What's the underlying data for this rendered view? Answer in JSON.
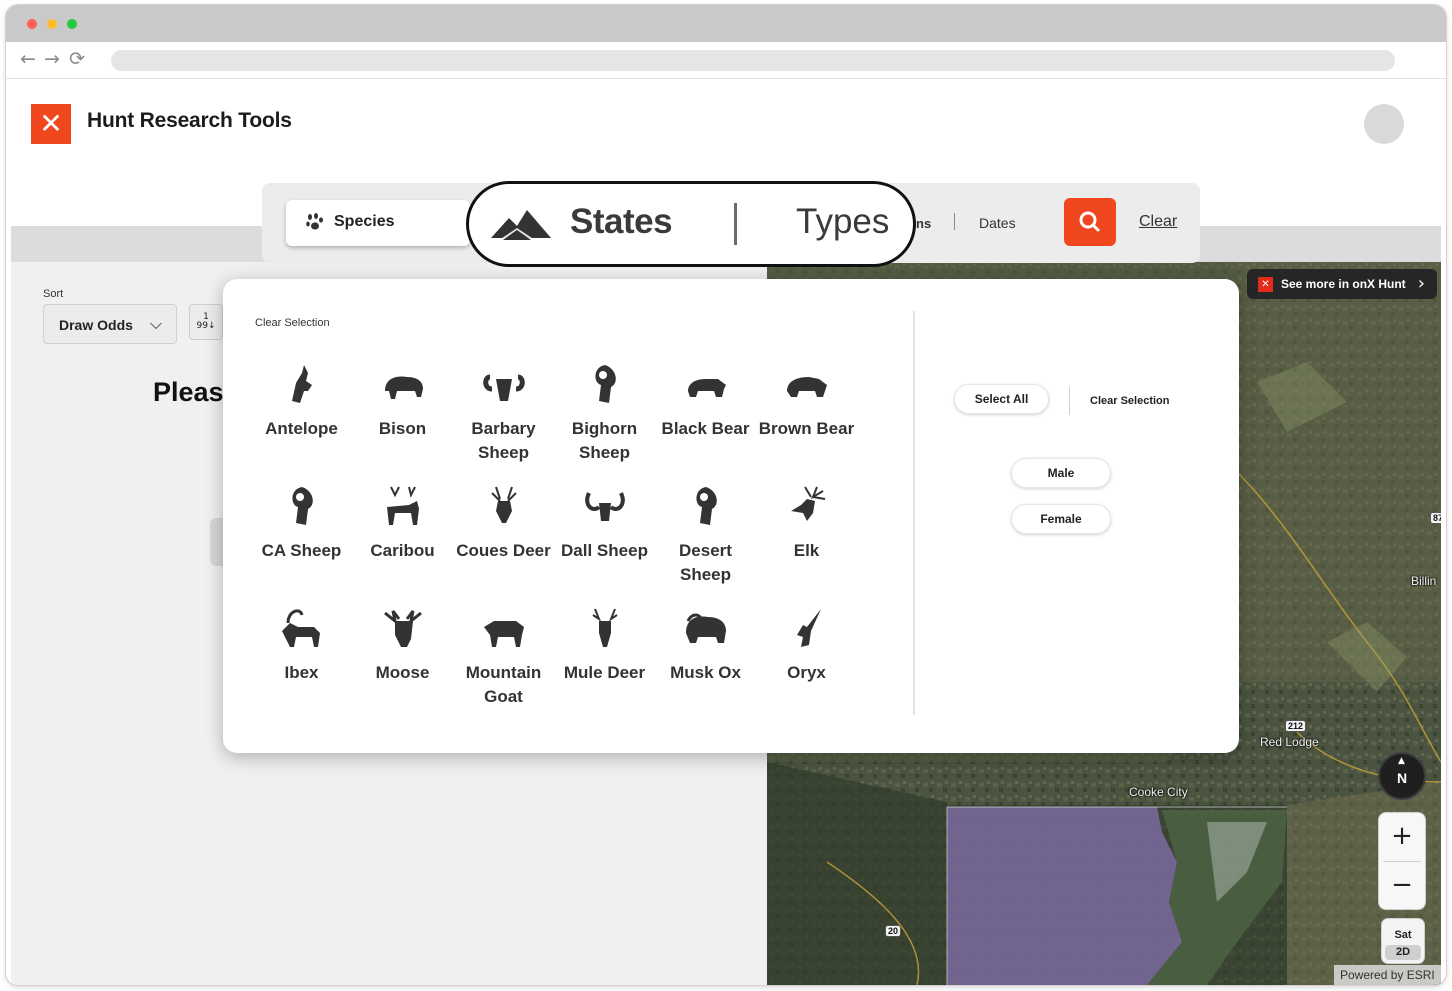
{
  "app": {
    "title": "Hunt Research Tools",
    "logo_glyph": "✕",
    "accent_color": "#f1471e"
  },
  "browser": {
    "back_glyph": "←",
    "forward_glyph": "→",
    "reload_glyph": "⟳"
  },
  "sidebar": {
    "sort_label": "Sort",
    "sort_value": "Draw Odds",
    "sort_chevron": "⌵",
    "sort_direction_top": "1",
    "sort_direction_bottom": "99↓",
    "prompt_partial": "Pleas"
  },
  "filters": {
    "species_label": "Species",
    "states_label": "States",
    "types_label": "Types",
    "seasons_partial": "ns",
    "dates_label": "Dates",
    "clear_label": "Clear"
  },
  "species_panel": {
    "clear_selection": "Clear Selection",
    "species": [
      {
        "name": "Antelope",
        "icon": "antelope-icon"
      },
      {
        "name": "Bison",
        "icon": "bison-icon"
      },
      {
        "name": "Barbary Sheep",
        "icon": "barbary-sheep-icon"
      },
      {
        "name": "Bighorn Sheep",
        "icon": "bighorn-sheep-icon"
      },
      {
        "name": "Black Bear",
        "icon": "black-bear-icon"
      },
      {
        "name": "Brown Bear",
        "icon": "brown-bear-icon"
      },
      {
        "name": "CA Sheep",
        "icon": "ca-sheep-icon"
      },
      {
        "name": "Caribou",
        "icon": "caribou-icon"
      },
      {
        "name": "Coues Deer",
        "icon": "coues-deer-icon"
      },
      {
        "name": "Dall Sheep",
        "icon": "dall-sheep-icon"
      },
      {
        "name": "Desert Sheep",
        "icon": "desert-sheep-icon"
      },
      {
        "name": "Elk",
        "icon": "elk-icon"
      },
      {
        "name": "Ibex",
        "icon": "ibex-icon"
      },
      {
        "name": "Moose",
        "icon": "moose-icon"
      },
      {
        "name": "Mountain Goat",
        "icon": "mountain-goat-icon"
      },
      {
        "name": "Mule Deer",
        "icon": "mule-deer-icon"
      },
      {
        "name": "Musk Ox",
        "icon": "musk-ox-icon"
      },
      {
        "name": "Oryx",
        "icon": "oryx-icon"
      }
    ]
  },
  "sex_panel": {
    "select_all": "Select All",
    "clear_selection": "Clear Selection",
    "options": [
      "Male",
      "Female"
    ]
  },
  "map": {
    "onx_link": "See more in onX Hunt",
    "onx_arrow": "›",
    "labels": {
      "red_lodge": "Red Lodge",
      "cooke_city": "Cooke City",
      "billings_partial": "Billin"
    },
    "road_badges": {
      "r212": "212",
      "r20": "20",
      "r87": "87"
    },
    "compass": "N",
    "compass_arrow": "▲",
    "zoom_in": "+",
    "zoom_out": "−",
    "sat_label": "Sat",
    "view_mode": "2D",
    "attribution": "Powered by ESRI"
  }
}
